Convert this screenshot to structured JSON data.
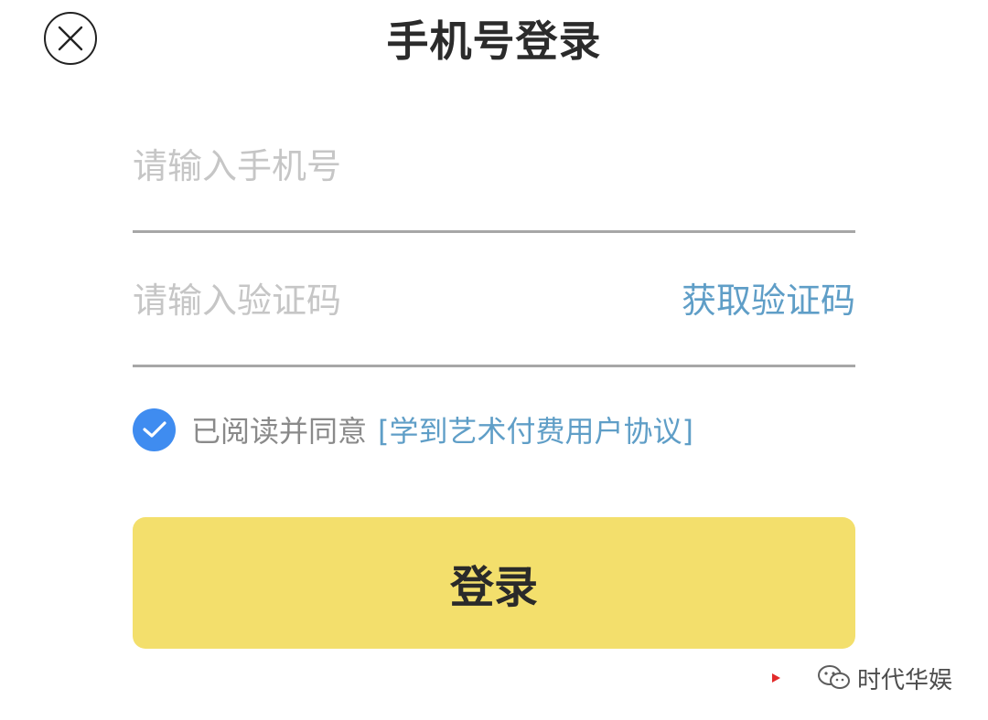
{
  "header": {
    "title": "手机号登录",
    "close_icon": "close-circle-icon"
  },
  "form": {
    "phone": {
      "value": "",
      "placeholder": "请输入手机号"
    },
    "code": {
      "value": "",
      "placeholder": "请输入验证码",
      "get_code_label": "获取验证码"
    },
    "agreement": {
      "checked": true,
      "text": "已阅读并同意",
      "link_text": "[学到艺术付费用户协议]"
    },
    "login_label": "登录"
  },
  "watermark": {
    "text": "时代华娱",
    "icon": "wechat-icon"
  },
  "colors": {
    "accent_yellow": "#f3df6c",
    "link_blue": "#5f9ec7",
    "checkbox_blue": "#3f8cf0",
    "divider_gray": "#a7a7a7"
  }
}
